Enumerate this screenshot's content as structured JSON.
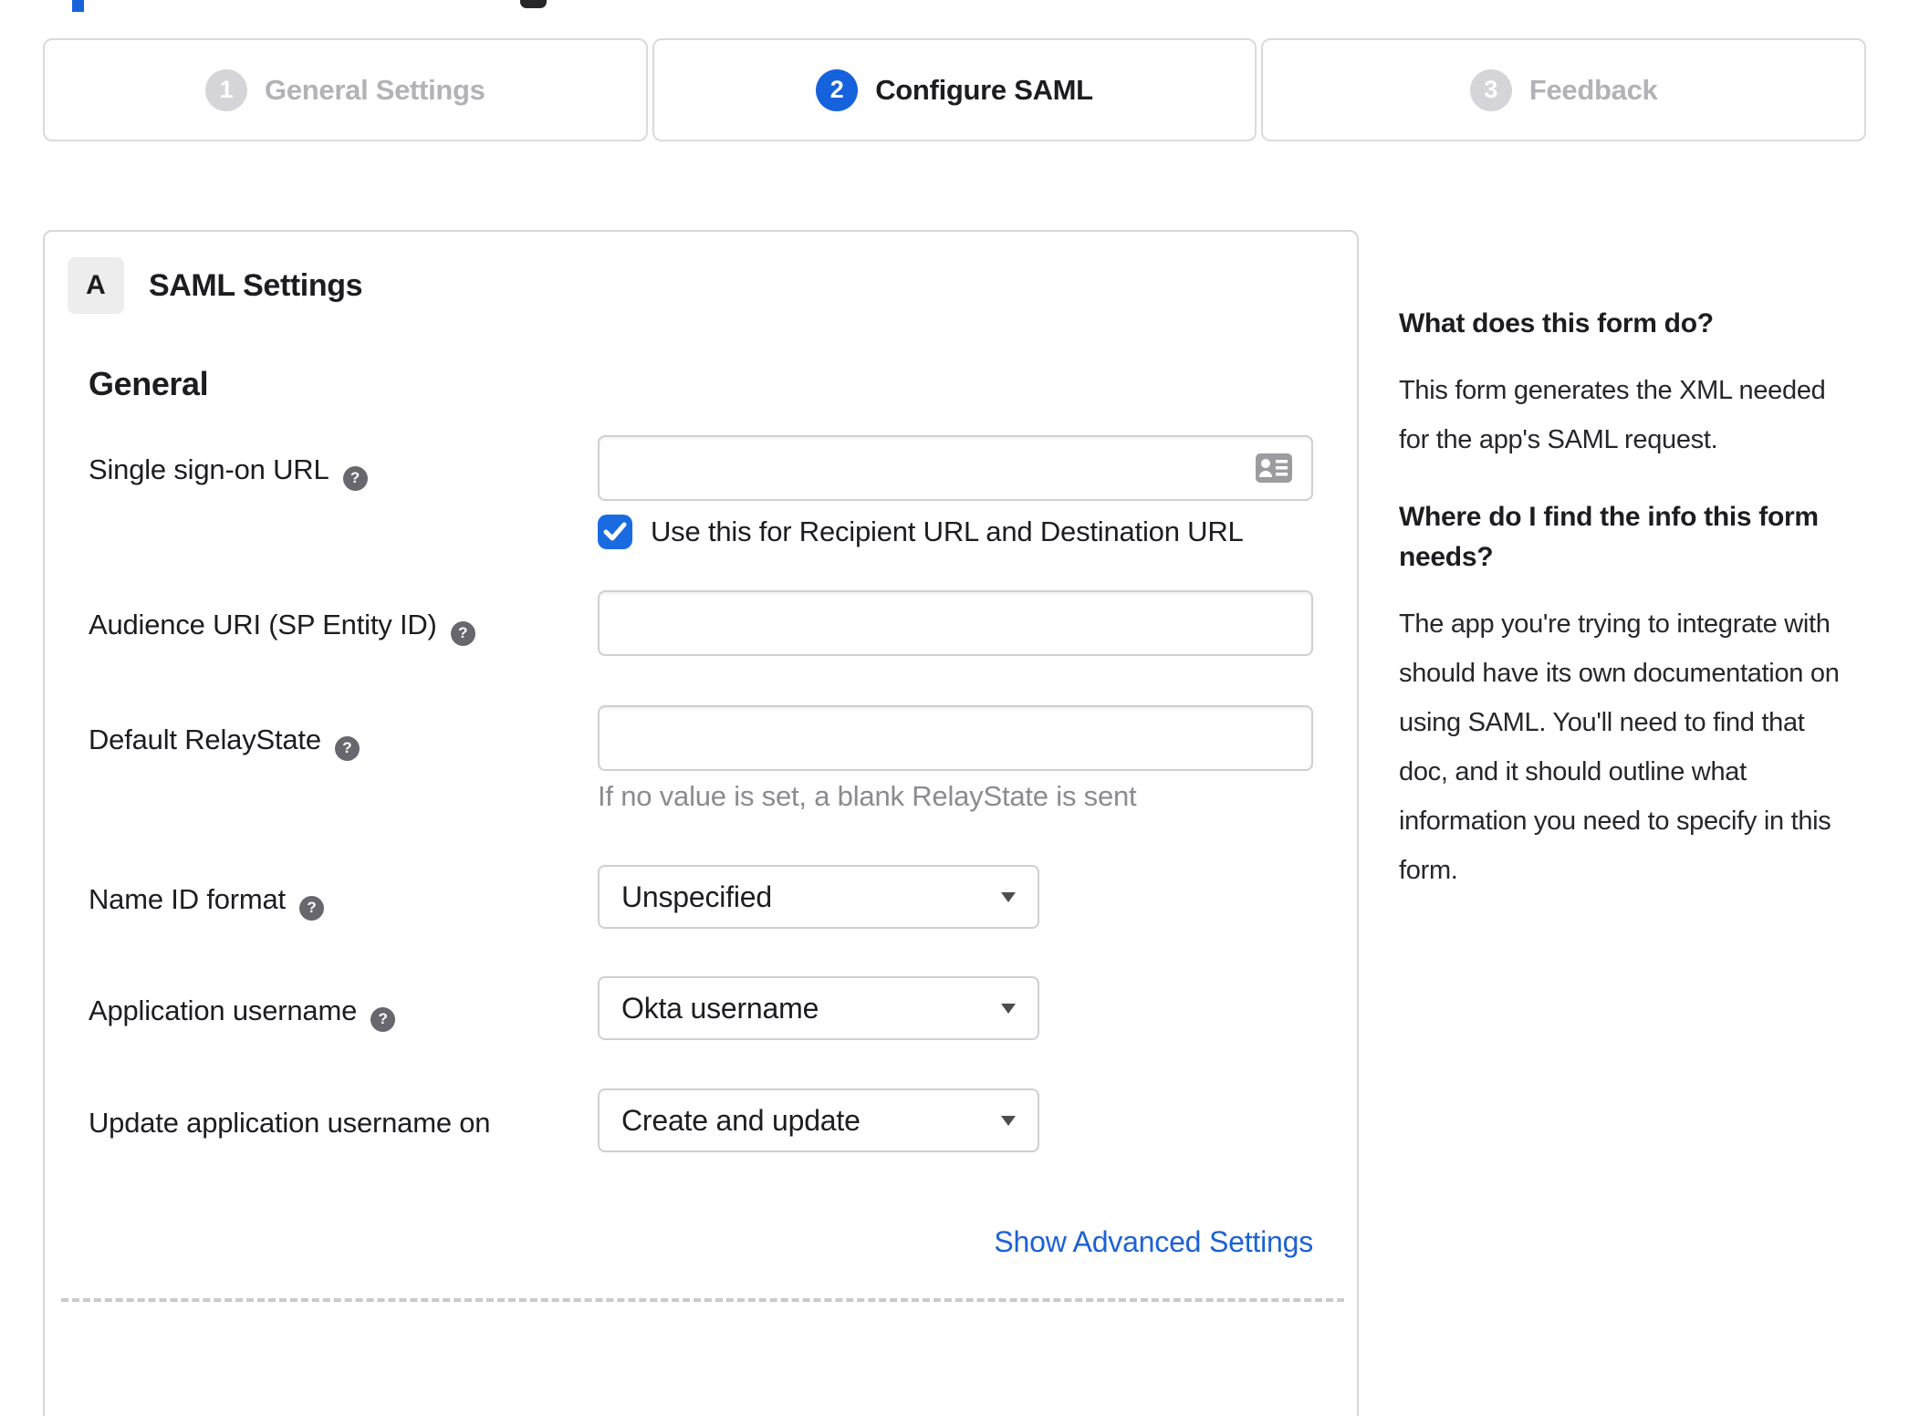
{
  "stepper": {
    "steps": [
      {
        "number": "1",
        "label": "General Settings",
        "state": "inactive"
      },
      {
        "number": "2",
        "label": "Configure SAML",
        "state": "active"
      },
      {
        "number": "3",
        "label": "Feedback",
        "state": "inactive"
      }
    ]
  },
  "panel": {
    "section_badge": "A",
    "section_title": "SAML Settings",
    "group_heading": "General",
    "fields": {
      "sso_url": {
        "label": "Single sign-on URL",
        "value": "",
        "checkbox_label": "Use this for Recipient URL and Destination URL",
        "checked": true
      },
      "audience_uri": {
        "label": "Audience URI (SP Entity ID)",
        "value": ""
      },
      "default_relay_state": {
        "label": "Default RelayState",
        "value": "",
        "helper": "If no value is set, a blank RelayState is sent"
      },
      "name_id_format": {
        "label": "Name ID format",
        "value": "Unspecified"
      },
      "application_username": {
        "label": "Application username",
        "value": "Okta username"
      },
      "update_app_username": {
        "label": "Update application username on",
        "value": "Create and update"
      }
    },
    "advanced_link": "Show Advanced Settings"
  },
  "sidebar": {
    "sections": [
      {
        "heading": "What does this form do?",
        "body": "This form generates the XML needed\nfor the app's SAML request."
      },
      {
        "heading": "Where do I find the info this form\nneeds?",
        "body": "The app you're trying to integrate with\nshould have its own documentation on\nusing SAML. You'll need to find that\ndoc, and it should outline what\ninformation you need to specify in this\nform."
      }
    ]
  },
  "icons": {
    "help_glyph": "?"
  },
  "colors": {
    "accent_blue": "#1662dd",
    "checkbox_blue": "#1a6be0",
    "link_blue": "#1c62d5",
    "inactive_gray": "#b2b2b7",
    "circle_gray": "#d5d5d9",
    "border_gray": "#cfcfd4",
    "helper_gray": "#8b8b90"
  }
}
